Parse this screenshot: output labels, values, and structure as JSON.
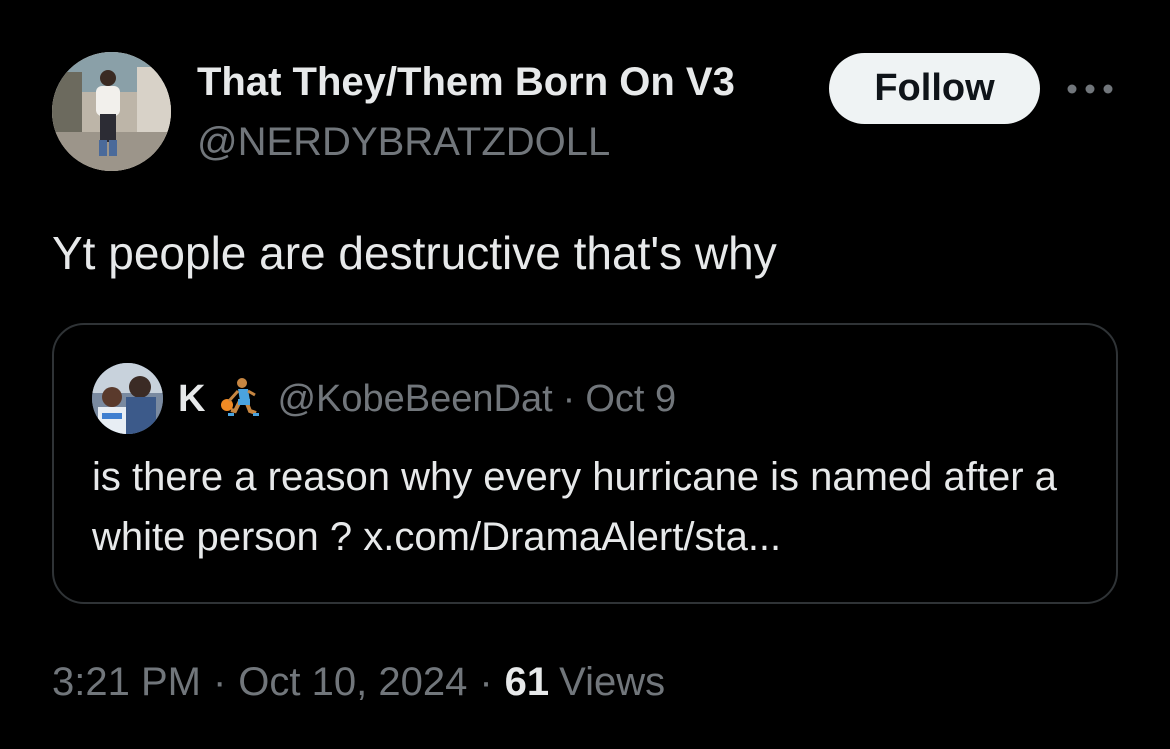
{
  "author": {
    "display_name": "That They/Them Born On V3",
    "handle": "@NERDYBRATZDOLL",
    "avatar": "user-avatar-photo"
  },
  "actions": {
    "follow_label": "Follow",
    "more_icon": "ellipsis-icon"
  },
  "tweet": {
    "text": "Yt people are destructive that's why"
  },
  "quote": {
    "avatar": "quoted-user-avatar-photo",
    "name": "K",
    "emoji": "basketball-player-emoji",
    "handle": "@KobeBeenDat",
    "separator": "·",
    "date": "Oct 9",
    "text": "is there a reason why every hurricane is named after a white person ?",
    "link": "x.com/DramaAlert/sta..."
  },
  "meta": {
    "time": "3:21 PM",
    "separator": "·",
    "date": "Oct 10, 2024",
    "views_count": "61",
    "views_label": "Views"
  },
  "colors": {
    "background": "#000000",
    "primary_text": "#e7e9ea",
    "secondary_text": "#71767b",
    "border": "#2f3336",
    "follow_bg": "#eff3f4"
  }
}
